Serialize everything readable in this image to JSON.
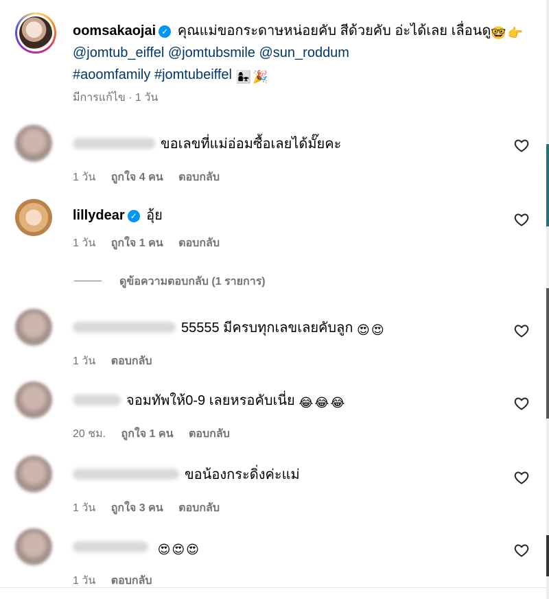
{
  "caption": {
    "username": "oomsakaojai",
    "text": "คุณแม่ขอกระดาษหน่อยคับ สีด้วยคับ อ่ะได้เลย เลื่อนดู",
    "mentions": [
      "@jomtub_eiffel",
      "@jomtubsmile",
      "@sun_roddum"
    ],
    "hashtags": [
      "#aoomfamily",
      "#jomtubeiffel"
    ],
    "meta": "มีการแก้ไข · 1 วัน"
  },
  "comments": [
    {
      "text": "ขอเลขที่แม่อ่อมซื้อเลยได้มั๊ยคะ",
      "time": "1 วัน",
      "likes": "ถูกใจ 4 คน",
      "reply": "ตอบกลับ"
    },
    {
      "username": "lillydear",
      "text": "อุ้ย",
      "time": "1 วัน",
      "likes": "ถูกใจ 1 คน",
      "reply": "ตอบกลับ"
    },
    {
      "text": "55555 มีครบทุกเลขเลยคับลูก",
      "time": "1 วัน",
      "reply": "ตอบกลับ"
    },
    {
      "text": "จอมทัพให้0-9 เลยหรอคับเนี่ย",
      "time": "20 ชม.",
      "likes": "ถูกใจ 1 คน",
      "reply": "ตอบกลับ"
    },
    {
      "text": "ขอน้องกระดิ่งค่ะแม่",
      "time": "1 วัน",
      "likes": "ถูกใจ 3 คน",
      "reply": "ตอบกลับ"
    },
    {
      "text": "",
      "time": "1 วัน",
      "reply": "ตอบกลับ"
    }
  ],
  "view_replies": "ดูข้อความตอบกลับ (1 รายการ)",
  "icons": {
    "heart": "heart-icon",
    "verified": "verified-badge-icon"
  },
  "colors": {
    "link": "#00376b",
    "meta": "#737373",
    "verified": "#0095f6"
  }
}
